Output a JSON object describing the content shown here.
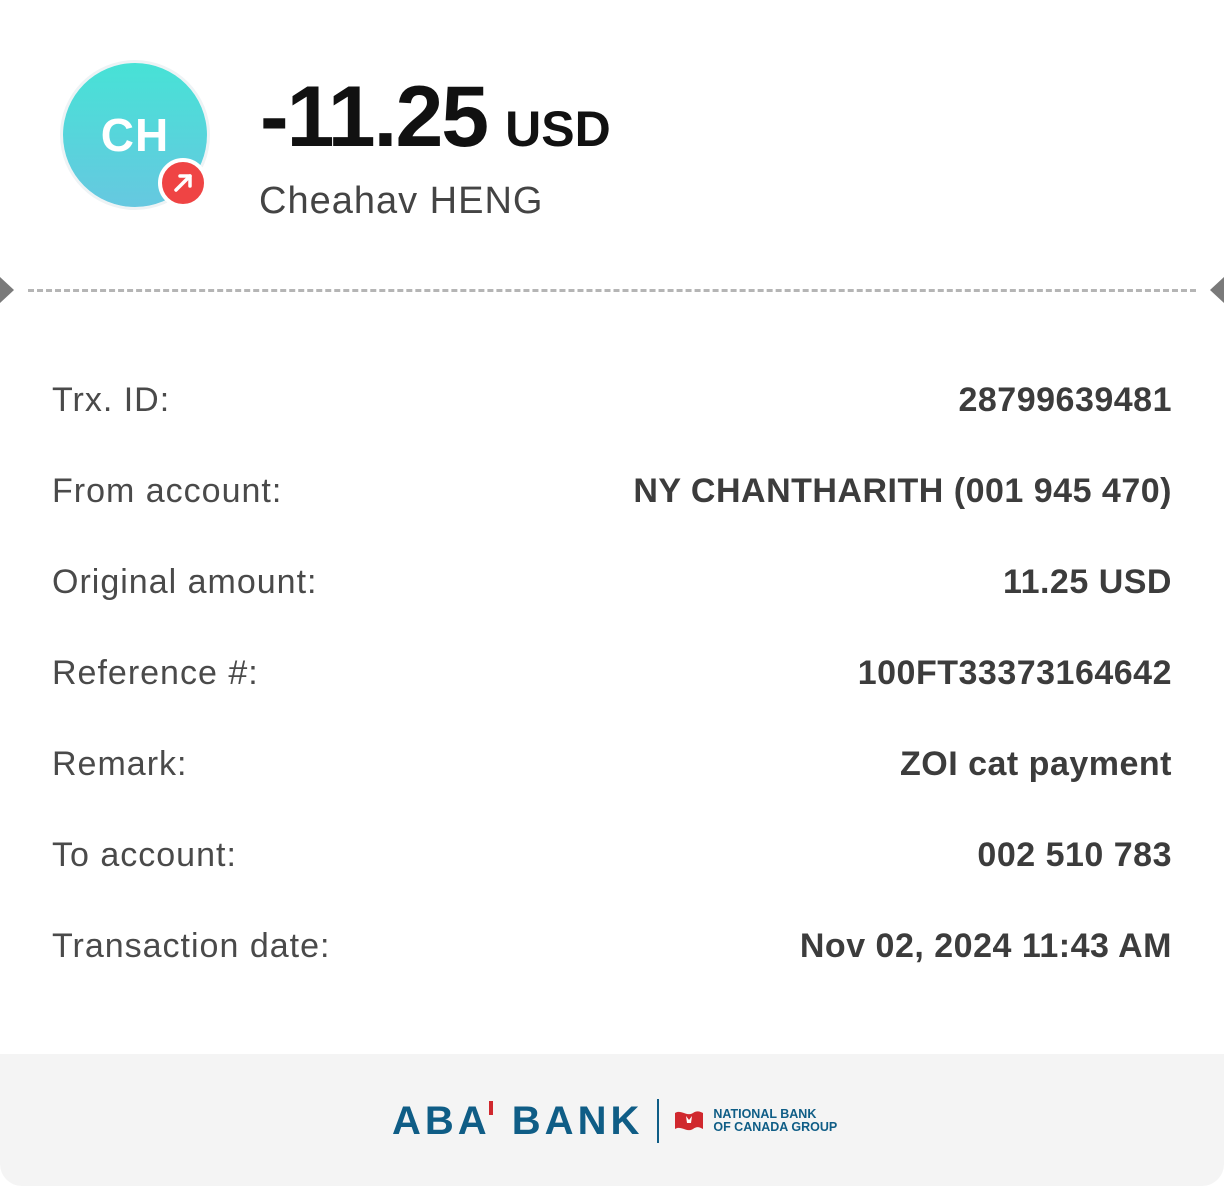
{
  "header": {
    "avatar_initials": "CH",
    "amount": "-11.25",
    "currency": "USD",
    "recipient_name": "Cheahav HENG",
    "direction": "outgoing"
  },
  "details": [
    {
      "label": "Trx. ID:",
      "value": "28799639481"
    },
    {
      "label": "From account:",
      "value": "NY CHANTHARITH (001 945 470)"
    },
    {
      "label": "Original amount:",
      "value": "11.25 USD"
    },
    {
      "label": "Reference #:",
      "value": "100FT33373164642"
    },
    {
      "label": "Remark:",
      "value": "ZOI cat payment"
    },
    {
      "label": "To account:",
      "value": "002 510 783"
    },
    {
      "label": "Transaction date:",
      "value": "Nov 02, 2024 11:43 AM"
    }
  ],
  "footer": {
    "bank_name_prefix": "ABA",
    "bank_name_suffix": "BANK",
    "group_line1": "NATIONAL BANK",
    "group_line2": "OF CANADA GROUP"
  },
  "colors": {
    "avatar_gradient_top": "#47e2d6",
    "avatar_gradient_bottom": "#66c8e0",
    "outgoing_badge": "#ef4444",
    "brand_blue": "#0f5d86",
    "brand_red": "#d0282e"
  }
}
